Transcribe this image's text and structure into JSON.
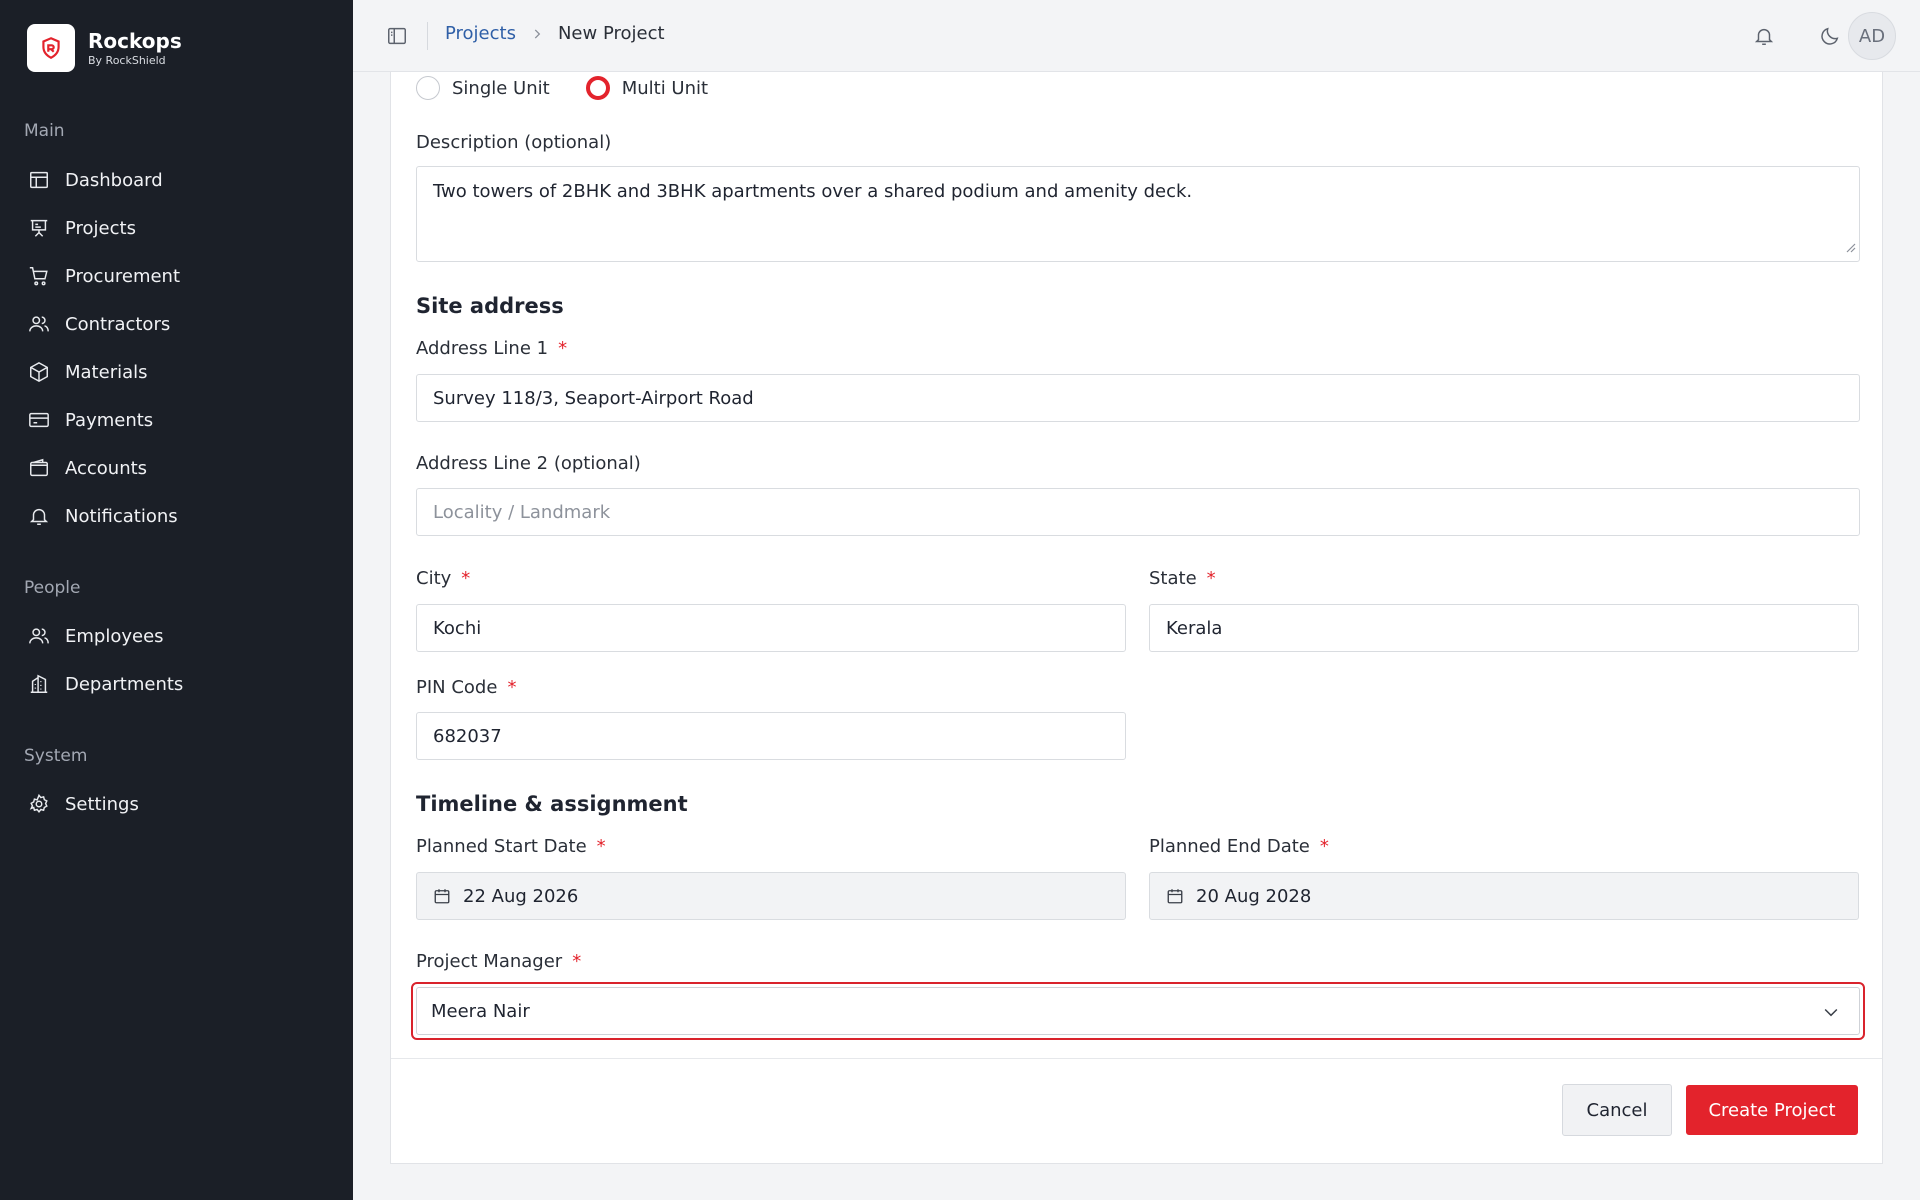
{
  "brand": {
    "name": "Rockops",
    "sub": "By RockShield"
  },
  "sidebar": {
    "sections": [
      {
        "title": "Main",
        "items": [
          {
            "label": "Dashboard",
            "icon": "dashboard-icon"
          },
          {
            "label": "Projects",
            "icon": "projects-icon"
          },
          {
            "label": "Procurement",
            "icon": "cart-icon"
          },
          {
            "label": "Contractors",
            "icon": "users-icon"
          },
          {
            "label": "Materials",
            "icon": "box-icon"
          },
          {
            "label": "Payments",
            "icon": "credit-card-icon"
          },
          {
            "label": "Accounts",
            "icon": "wallet-icon"
          },
          {
            "label": "Notifications",
            "icon": "bell-icon"
          }
        ]
      },
      {
        "title": "People",
        "items": [
          {
            "label": "Employees",
            "icon": "users-icon"
          },
          {
            "label": "Departments",
            "icon": "building-icon"
          }
        ]
      },
      {
        "title": "System",
        "items": [
          {
            "label": "Settings",
            "icon": "gear-icon"
          }
        ]
      }
    ]
  },
  "topbar": {
    "breadcrumb": {
      "parent": "Projects",
      "current": "New Project"
    },
    "avatar_initials": "AD"
  },
  "form": {
    "unit_type": {
      "options": [
        "Single Unit",
        "Multi Unit"
      ],
      "selected": "Multi Unit"
    },
    "description": {
      "label": "Description (optional)",
      "value": "Two towers of 2BHK and 3BHK apartments over a shared podium and amenity deck."
    },
    "site_address_title": "Site address",
    "address1": {
      "label": "Address Line 1",
      "required_mark": "*",
      "value": "Survey 118/3, Seaport-Airport Road"
    },
    "address2": {
      "label": "Address Line 2 (optional)",
      "placeholder": "Locality / Landmark"
    },
    "city": {
      "label": "City",
      "required_mark": "*",
      "value": "Kochi"
    },
    "state": {
      "label": "State",
      "required_mark": "*",
      "value": "Kerala"
    },
    "pin": {
      "label": "PIN Code",
      "required_mark": "*",
      "value": "682037"
    },
    "timeline_title": "Timeline & assignment",
    "start_date": {
      "label": "Planned Start Date",
      "required_mark": "*",
      "value": "22 Aug 2026"
    },
    "end_date": {
      "label": "Planned End Date",
      "required_mark": "*",
      "value": "20 Aug 2028"
    },
    "manager": {
      "label": "Project Manager",
      "required_mark": "*",
      "value": "Meera Nair"
    }
  },
  "actions": {
    "cancel": "Cancel",
    "create": "Create Project"
  },
  "colors": {
    "accent": "#e3232c",
    "sidebar_bg": "#1b1f27",
    "link": "#2f5fa7"
  }
}
